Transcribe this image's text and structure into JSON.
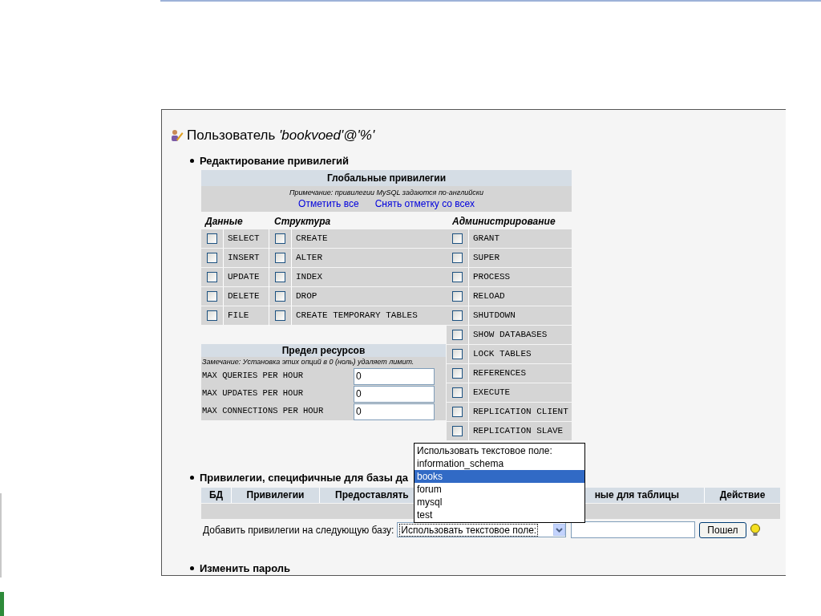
{
  "title": {
    "prefix": "Пользователь ",
    "user": "'bookvoed'@'%'"
  },
  "edit_section": {
    "heading": "Редактирование привилегий",
    "global": {
      "title": "Глобальные привилегии",
      "note": "Примечание: привилегии MySQL задаются по-английски",
      "links": [
        "Отметить все",
        "Снять отметку со всех"
      ],
      "groups": [
        {
          "name": "Данные",
          "items": [
            {
              "label": "SELECT",
              "checked": false
            },
            {
              "label": "INSERT",
              "checked": false
            },
            {
              "label": "UPDATE",
              "checked": false
            },
            {
              "label": "DELETE",
              "checked": false
            },
            {
              "label": "FILE",
              "checked": false
            }
          ]
        },
        {
          "name": "Структура",
          "items": [
            {
              "label": "CREATE",
              "checked": false
            },
            {
              "label": "ALTER",
              "checked": false
            },
            {
              "label": "INDEX",
              "checked": false
            },
            {
              "label": "DROP",
              "checked": false
            },
            {
              "label": "CREATE TEMPORARY TABLES",
              "checked": false
            }
          ]
        },
        {
          "name": "Администрирование",
          "items": [
            {
              "label": "GRANT",
              "checked": false
            },
            {
              "label": "SUPER",
              "checked": false
            },
            {
              "label": "PROCESS",
              "checked": false
            },
            {
              "label": "RELOAD",
              "checked": false
            },
            {
              "label": "SHUTDOWN",
              "checked": false
            },
            {
              "label": "SHOW DATABASES",
              "checked": false
            },
            {
              "label": "LOCK TABLES",
              "checked": false
            },
            {
              "label": "REFERENCES",
              "checked": false
            },
            {
              "label": "EXECUTE",
              "checked": false
            },
            {
              "label": "REPLICATION CLIENT",
              "checked": false
            },
            {
              "label": "REPLICATION SLAVE",
              "checked": false
            }
          ]
        }
      ]
    },
    "resources": {
      "title": "Предел ресурсов",
      "note": "Замечание: Установка этих опций в 0 (ноль) удаляет лимит.",
      "rows": [
        {
          "label": "MAX QUERIES PER HOUR",
          "value": "0"
        },
        {
          "label": "MAX UPDATES PER HOUR",
          "value": "0"
        },
        {
          "label": "MAX CONNECTIONS PER HOUR",
          "value": "0"
        }
      ]
    }
  },
  "db_section": {
    "heading": "Привилегии, специфичные для базы да",
    "columns": [
      "БД",
      "Привилегии",
      "Предоставлять",
      "ные для таблицы",
      "Действие"
    ],
    "add_label": "Добавить привилегии на следующую базу:",
    "select_value": "Использовать текстовое поле:",
    "button": "Пошел",
    "dropdown": [
      {
        "label": "Использовать текстовое поле:",
        "selected": false
      },
      {
        "label": "information_schema",
        "selected": false
      },
      {
        "label": "books",
        "selected": true
      },
      {
        "label": "forum",
        "selected": false
      },
      {
        "label": "mysql",
        "selected": false
      },
      {
        "label": "test",
        "selected": false
      }
    ]
  },
  "password_section": {
    "heading": "Изменить пароль"
  }
}
